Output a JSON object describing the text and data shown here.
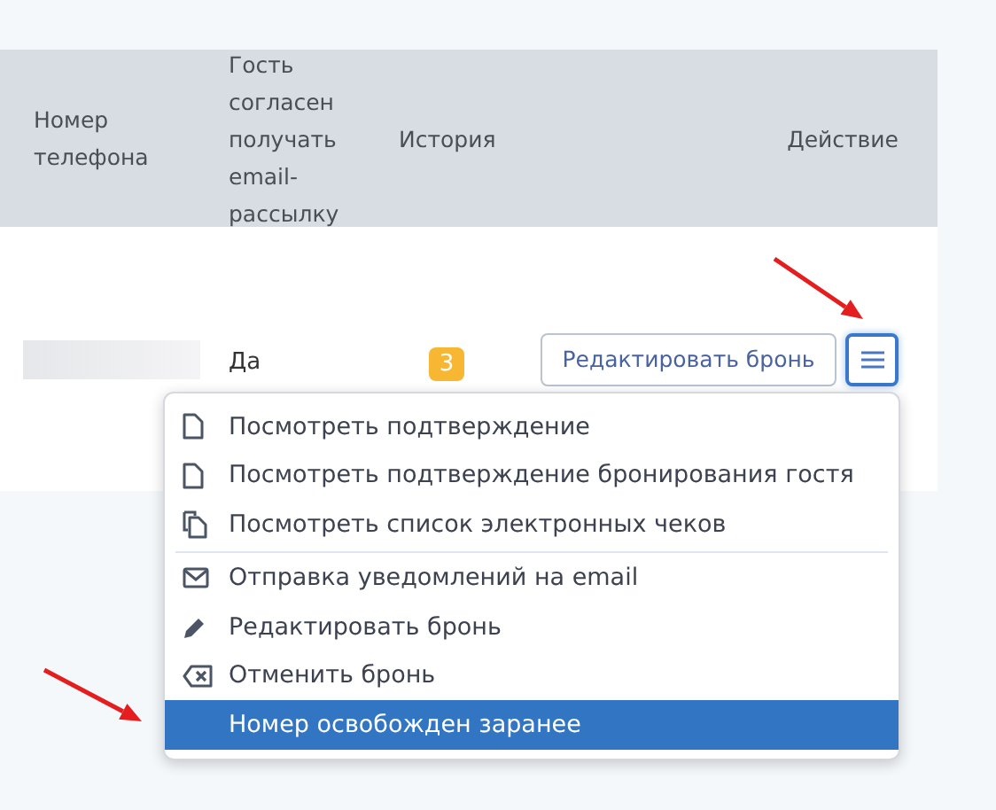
{
  "table": {
    "columns": [
      "Номер телефона",
      "Гость согласен получать email-рассылку",
      "История",
      "Действие"
    ],
    "rows": [
      {
        "phone_redacted": true,
        "consent": "Да",
        "history_count": "3",
        "edit_button": "Редактировать бронь",
        "menu_open": true
      }
    ]
  },
  "menu": {
    "groups": [
      [
        {
          "kind": "document",
          "label": "Посмотреть подтверждение",
          "selected": false
        },
        {
          "kind": "document",
          "label": "Посмотреть подтверждение бронирования гостя",
          "selected": false
        },
        {
          "kind": "documents",
          "label": "Посмотреть список электронных чеков",
          "selected": false
        }
      ],
      [
        {
          "kind": "mail",
          "label": "Отправка уведомлений на email",
          "selected": false
        },
        {
          "kind": "pencil",
          "label": "Редактировать бронь",
          "selected": false
        },
        {
          "kind": "cancel",
          "label": "Отменить бронь",
          "selected": false
        },
        {
          "kind": "plain",
          "label": "Номер освобожден заранее",
          "selected": true
        }
      ]
    ]
  },
  "annotations": [
    {
      "kind": "arrow"
    },
    {
      "kind": "arrow"
    }
  ]
}
